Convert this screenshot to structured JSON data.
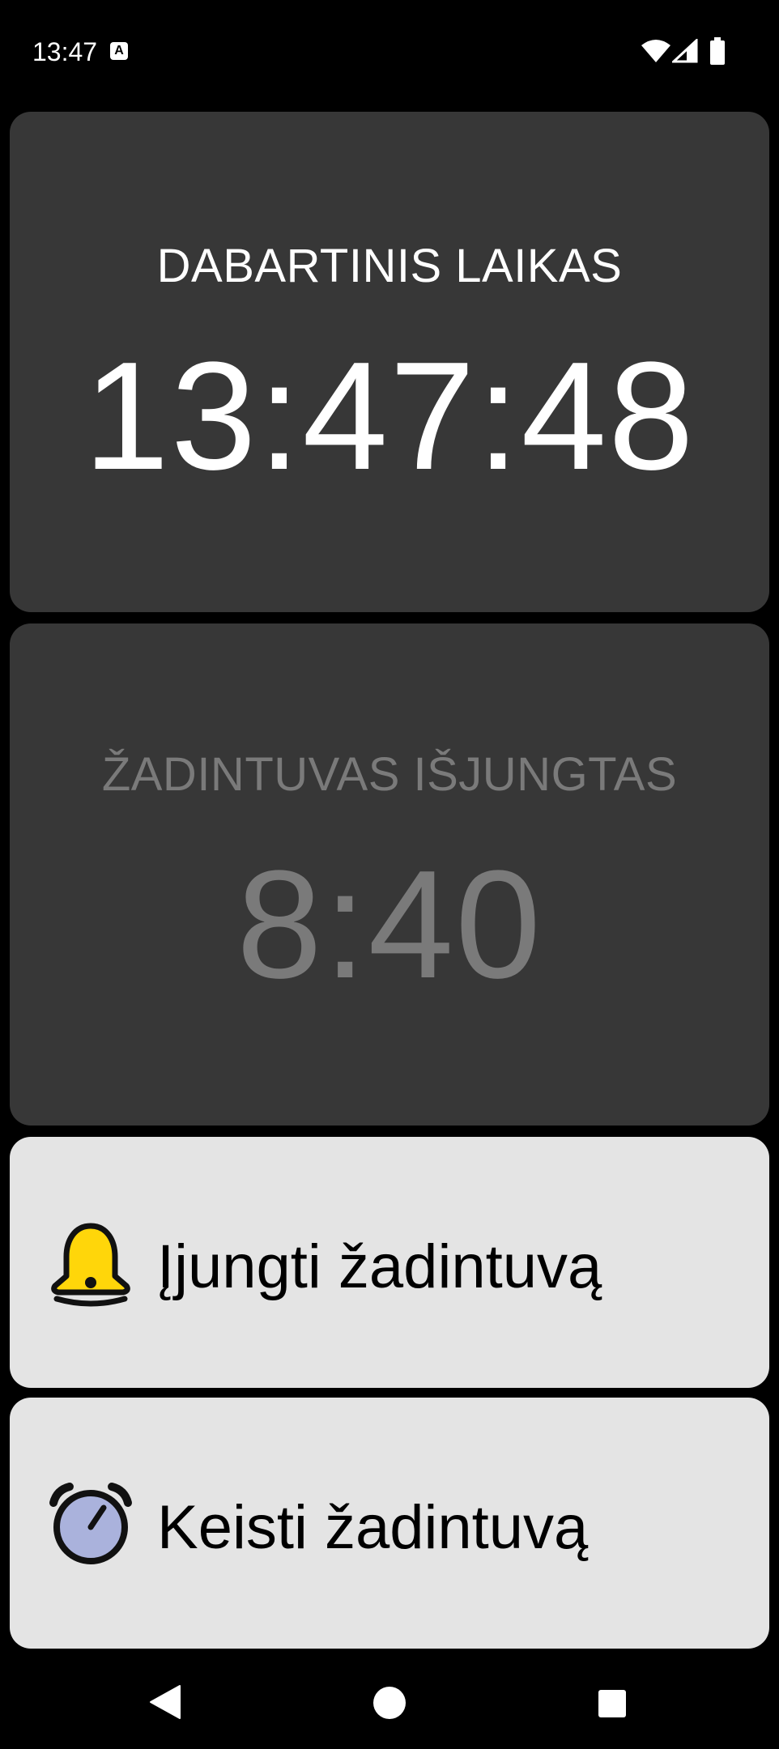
{
  "status_bar": {
    "time": "13:47",
    "notification_icon_letter": "A"
  },
  "current_time_card": {
    "label": "DABARTINIS LAIKAS",
    "time": "13:47:48"
  },
  "alarm_card": {
    "label": "ŽADINTUVAS IŠJUNGTAS",
    "time": "8:40"
  },
  "actions": {
    "enable_alarm": {
      "label": "Įjungti žadintuvą",
      "icon": "bell-icon"
    },
    "change_alarm": {
      "label": "Keisti žadintuvą",
      "icon": "alarm-clock-icon"
    }
  },
  "colors": {
    "background": "#000000",
    "card_dark": "#373737",
    "card_light": "#e4e4e4",
    "disabled_text": "#7a7a7a",
    "bell_yellow": "#ffd60a",
    "clock_face": "#aab2dc"
  },
  "nav_bar": {
    "icons": [
      "back-icon",
      "home-icon",
      "recents-icon"
    ]
  }
}
